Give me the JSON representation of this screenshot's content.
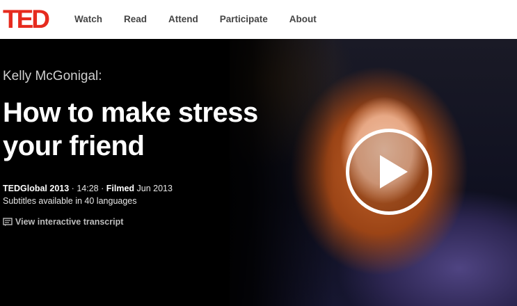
{
  "header": {
    "logo_text": "TED",
    "nav": [
      {
        "label": "Watch"
      },
      {
        "label": "Read"
      },
      {
        "label": "Attend"
      },
      {
        "label": "Participate"
      },
      {
        "label": "About"
      }
    ]
  },
  "talk": {
    "speaker": "Kelly McGonigal:",
    "title": "How to make stress your friend",
    "event": "TEDGlobal 2013",
    "separator": "·",
    "duration": "14:28",
    "filmed_label": "Filmed",
    "filmed_date": "Jun 2013",
    "subtitles": "Subtitles available in 40 languages",
    "transcript_link": "View interactive transcript"
  },
  "icons": {
    "transcript": "transcript-icon",
    "play": "play-icon"
  },
  "colors": {
    "brand": "#e62b1e",
    "hero_bg": "#000000",
    "nav_text": "#444444"
  }
}
